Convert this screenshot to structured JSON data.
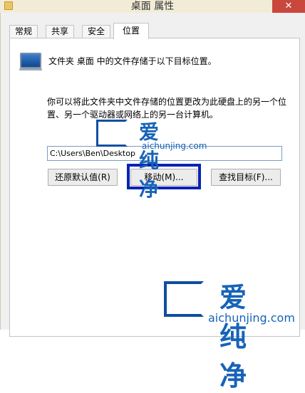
{
  "window": {
    "title": "桌面 属性",
    "close_label": "✕"
  },
  "tabs": [
    {
      "label": "常规"
    },
    {
      "label": "共享"
    },
    {
      "label": "安全"
    },
    {
      "label": "位置",
      "active": true
    }
  ],
  "location": {
    "description": "文件夹 桌面 中的文件存储于以下目标位置。",
    "info": "你可以将此文件夹中文件存储的位置更改为此硬盘上的另一个位置、另一个驱动器或网络上的另一台计算机。",
    "path_value": "C:\\Users\\Ben\\Desktop",
    "restore_label": "还原默认值(R)",
    "move_label": "移动(M)...",
    "find_target_label": "查找目标(F)..."
  },
  "watermark": {
    "cn": "爱纯净",
    "en": "aichunjing.com"
  },
  "colors": {
    "highlight_border": "#0a23b4",
    "close_button": "#c9473c",
    "watermark": "#1663b8"
  }
}
